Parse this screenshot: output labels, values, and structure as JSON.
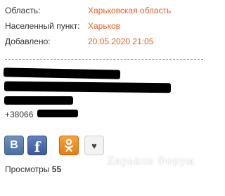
{
  "info": {
    "region_label": "Область:",
    "region_value": "Харьковская область",
    "city_label": "Населенный пункт:",
    "city_value": "Харьков",
    "added_label": "Добавлено:",
    "added_value": "20.05.2020 21:05"
  },
  "contacts": {
    "phone_prefix": "+38066"
  },
  "share": {
    "vk_icon": "vk-icon",
    "facebook_icon": "facebook-icon",
    "odnoklassniki_icon": "odnoklassniki-icon",
    "favorite_icon": "heart-icon"
  },
  "stats": {
    "views_label": "Просмотры",
    "views_count": "55"
  },
  "watermark": {
    "text": "Харьков Форум"
  },
  "colors": {
    "value_accent": "#e0622a",
    "vk": "#4a6fa0",
    "facebook": "#3b5998",
    "odnoklassniki": "#e67d0f"
  }
}
